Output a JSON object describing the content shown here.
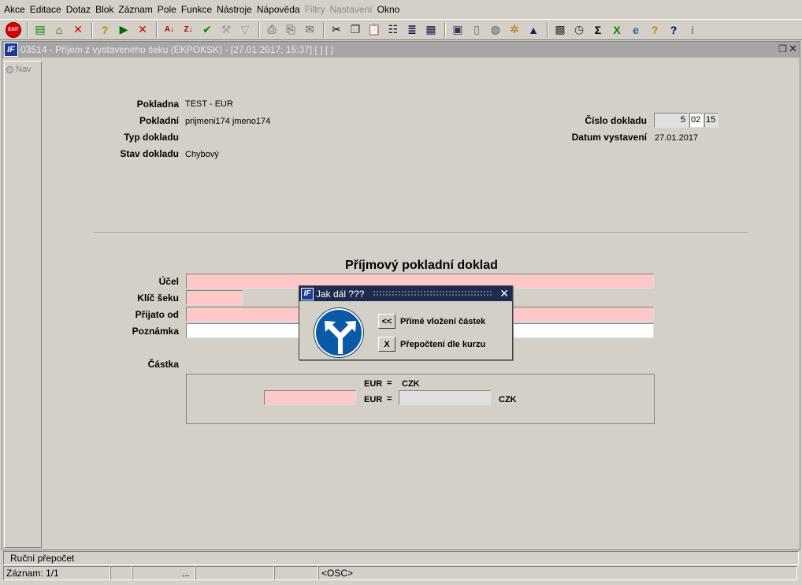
{
  "menu": [
    "Akce",
    "Editace",
    "Dotaz",
    "Blok",
    "Záznam",
    "Pole",
    "Funkce",
    "Nástroje",
    "Nápověda",
    "Filtry",
    "Nastavení",
    "Okno"
  ],
  "menu_disabled": [
    "Filtry",
    "Nastavení"
  ],
  "toolbar": {
    "exit_label": "EXIT",
    "buttons": [
      "add-record",
      "insert",
      "delete-record",
      "query-new",
      "query-run",
      "query-cancel",
      "sort-asc",
      "sort-desc",
      "commit",
      "wrench",
      "filter",
      "print",
      "print-setup",
      "mail",
      "cut",
      "copy",
      "paste",
      "tree",
      "list",
      "grid",
      "clipboard",
      "doc",
      "globe",
      "wheel",
      "triangle",
      "calendar",
      "clock",
      "sum",
      "excel",
      "internet",
      "help",
      "help2",
      "info"
    ],
    "sigma": "Σ",
    "help_glyph": "?",
    "info_glyph": "i"
  },
  "window": {
    "title": "03514 - Příjem z vystaveného šeku (EKPOKSK) - [27.01.2017; 15:37]  [ ]  [ ]",
    "logo": "IF",
    "nav_label": "Nav"
  },
  "header": {
    "pokladna_label": "Pokladna",
    "pokladna_value": "TEST - EUR",
    "pokladni_label": "Pokladní",
    "pokladni_value": "prijmeni174 jmeno174",
    "typ_label": "Typ dokladu",
    "stav_label": "Stav dokladu",
    "stav_value": "Chybový",
    "cislo_label": "Číslo dokladu",
    "cislo_part1": "5",
    "cislo_part2": "02",
    "cislo_part3": "15",
    "datum_label": "Datum vystavení",
    "datum_value": "27.01.2017"
  },
  "form": {
    "title": "Příjmový pokladní doklad",
    "ucel_label": "Účel",
    "klic_label": "Klíč šeku",
    "prijato_label": "Přijato od",
    "poznamka_label": "Poznámka",
    "castka_label": "Částka",
    "ccy_top_left": "EUR",
    "eq_top": "=",
    "ccy_top_right": "CZK",
    "ccy_row_left": "EUR",
    "eq_row": "=",
    "ccy_row_right": "CZK"
  },
  "dialog": {
    "title": "Jak dál ???",
    "close": "✕",
    "btn1": "<<",
    "btn1_label": "Přímé vložení částek",
    "btn2": "X",
    "btn2_label": "Přepočtení dle kurzu"
  },
  "status": {
    "message": "Ruční přepočet",
    "record": "Záznam: 1/1",
    "ellipsis": "...",
    "osc": "<OSC>"
  },
  "colors": {
    "required_field": "#ffc8c8",
    "dialog_title": "#1e2a50",
    "sign_blue": "#0a5aa6"
  }
}
